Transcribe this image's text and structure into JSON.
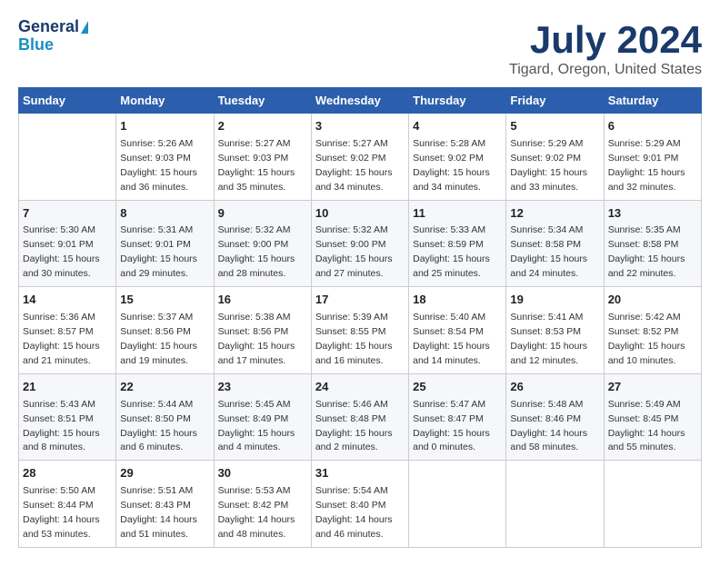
{
  "logo": {
    "line1": "General",
    "line2": "Blue"
  },
  "title": "July 2024",
  "subtitle": "Tigard, Oregon, United States",
  "weekdays": [
    "Sunday",
    "Monday",
    "Tuesday",
    "Wednesday",
    "Thursday",
    "Friday",
    "Saturday"
  ],
  "weeks": [
    [
      {
        "day": "",
        "info": ""
      },
      {
        "day": "1",
        "info": "Sunrise: 5:26 AM\nSunset: 9:03 PM\nDaylight: 15 hours\nand 36 minutes."
      },
      {
        "day": "2",
        "info": "Sunrise: 5:27 AM\nSunset: 9:03 PM\nDaylight: 15 hours\nand 35 minutes."
      },
      {
        "day": "3",
        "info": "Sunrise: 5:27 AM\nSunset: 9:02 PM\nDaylight: 15 hours\nand 34 minutes."
      },
      {
        "day": "4",
        "info": "Sunrise: 5:28 AM\nSunset: 9:02 PM\nDaylight: 15 hours\nand 34 minutes."
      },
      {
        "day": "5",
        "info": "Sunrise: 5:29 AM\nSunset: 9:02 PM\nDaylight: 15 hours\nand 33 minutes."
      },
      {
        "day": "6",
        "info": "Sunrise: 5:29 AM\nSunset: 9:01 PM\nDaylight: 15 hours\nand 32 minutes."
      }
    ],
    [
      {
        "day": "7",
        "info": "Sunrise: 5:30 AM\nSunset: 9:01 PM\nDaylight: 15 hours\nand 30 minutes."
      },
      {
        "day": "8",
        "info": "Sunrise: 5:31 AM\nSunset: 9:01 PM\nDaylight: 15 hours\nand 29 minutes."
      },
      {
        "day": "9",
        "info": "Sunrise: 5:32 AM\nSunset: 9:00 PM\nDaylight: 15 hours\nand 28 minutes."
      },
      {
        "day": "10",
        "info": "Sunrise: 5:32 AM\nSunset: 9:00 PM\nDaylight: 15 hours\nand 27 minutes."
      },
      {
        "day": "11",
        "info": "Sunrise: 5:33 AM\nSunset: 8:59 PM\nDaylight: 15 hours\nand 25 minutes."
      },
      {
        "day": "12",
        "info": "Sunrise: 5:34 AM\nSunset: 8:58 PM\nDaylight: 15 hours\nand 24 minutes."
      },
      {
        "day": "13",
        "info": "Sunrise: 5:35 AM\nSunset: 8:58 PM\nDaylight: 15 hours\nand 22 minutes."
      }
    ],
    [
      {
        "day": "14",
        "info": "Sunrise: 5:36 AM\nSunset: 8:57 PM\nDaylight: 15 hours\nand 21 minutes."
      },
      {
        "day": "15",
        "info": "Sunrise: 5:37 AM\nSunset: 8:56 PM\nDaylight: 15 hours\nand 19 minutes."
      },
      {
        "day": "16",
        "info": "Sunrise: 5:38 AM\nSunset: 8:56 PM\nDaylight: 15 hours\nand 17 minutes."
      },
      {
        "day": "17",
        "info": "Sunrise: 5:39 AM\nSunset: 8:55 PM\nDaylight: 15 hours\nand 16 minutes."
      },
      {
        "day": "18",
        "info": "Sunrise: 5:40 AM\nSunset: 8:54 PM\nDaylight: 15 hours\nand 14 minutes."
      },
      {
        "day": "19",
        "info": "Sunrise: 5:41 AM\nSunset: 8:53 PM\nDaylight: 15 hours\nand 12 minutes."
      },
      {
        "day": "20",
        "info": "Sunrise: 5:42 AM\nSunset: 8:52 PM\nDaylight: 15 hours\nand 10 minutes."
      }
    ],
    [
      {
        "day": "21",
        "info": "Sunrise: 5:43 AM\nSunset: 8:51 PM\nDaylight: 15 hours\nand 8 minutes."
      },
      {
        "day": "22",
        "info": "Sunrise: 5:44 AM\nSunset: 8:50 PM\nDaylight: 15 hours\nand 6 minutes."
      },
      {
        "day": "23",
        "info": "Sunrise: 5:45 AM\nSunset: 8:49 PM\nDaylight: 15 hours\nand 4 minutes."
      },
      {
        "day": "24",
        "info": "Sunrise: 5:46 AM\nSunset: 8:48 PM\nDaylight: 15 hours\nand 2 minutes."
      },
      {
        "day": "25",
        "info": "Sunrise: 5:47 AM\nSunset: 8:47 PM\nDaylight: 15 hours\nand 0 minutes."
      },
      {
        "day": "26",
        "info": "Sunrise: 5:48 AM\nSunset: 8:46 PM\nDaylight: 14 hours\nand 58 minutes."
      },
      {
        "day": "27",
        "info": "Sunrise: 5:49 AM\nSunset: 8:45 PM\nDaylight: 14 hours\nand 55 minutes."
      }
    ],
    [
      {
        "day": "28",
        "info": "Sunrise: 5:50 AM\nSunset: 8:44 PM\nDaylight: 14 hours\nand 53 minutes."
      },
      {
        "day": "29",
        "info": "Sunrise: 5:51 AM\nSunset: 8:43 PM\nDaylight: 14 hours\nand 51 minutes."
      },
      {
        "day": "30",
        "info": "Sunrise: 5:53 AM\nSunset: 8:42 PM\nDaylight: 14 hours\nand 48 minutes."
      },
      {
        "day": "31",
        "info": "Sunrise: 5:54 AM\nSunset: 8:40 PM\nDaylight: 14 hours\nand 46 minutes."
      },
      {
        "day": "",
        "info": ""
      },
      {
        "day": "",
        "info": ""
      },
      {
        "day": "",
        "info": ""
      }
    ]
  ]
}
